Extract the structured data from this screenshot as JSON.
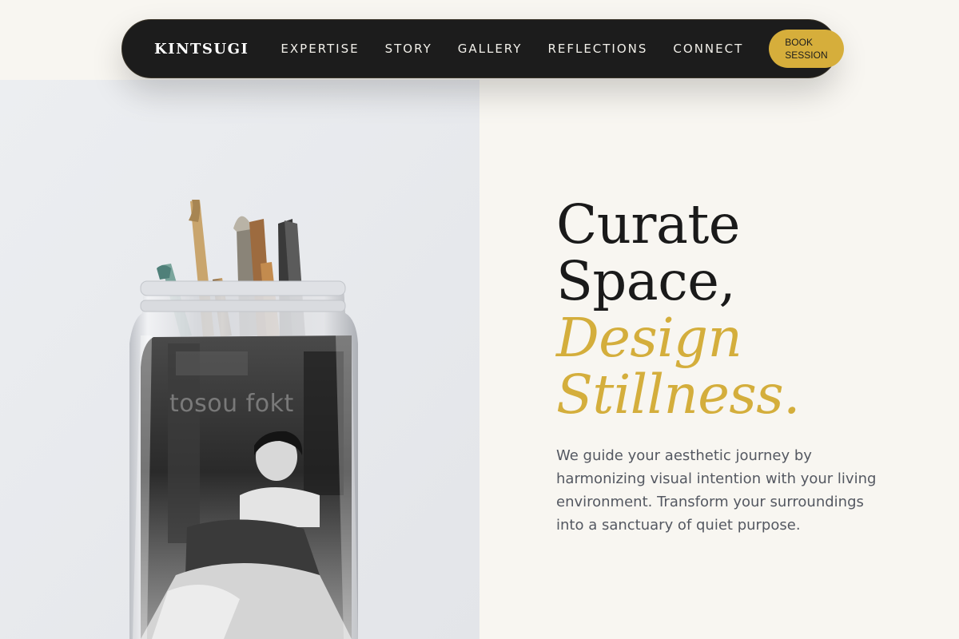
{
  "nav": {
    "brand": "KINTSUGI",
    "links": [
      "EXPERTISE",
      "STORY",
      "GALLERY",
      "REFLECTIONS",
      "CONNECT"
    ],
    "cta": "BOOK SESSION"
  },
  "hero": {
    "headline_line1": "Curate",
    "headline_line2": "Space,",
    "headline_accent_line1": "Design",
    "headline_accent_line2": "Stillness.",
    "lead": "We guide your aesthetic journey by harmonizing visual intention with your living environment. Transform your surroundings into a sanctuary of quiet purpose.",
    "image_watermark": "tosou fokt"
  },
  "colors": {
    "accent": "#d4ae3c",
    "nav_bg": "#1c1c1c",
    "page_bg": "#f8f6f1",
    "panel_bg": "#e8e9ec",
    "text_dark": "#1a1a1a",
    "text_muted": "#545861"
  }
}
